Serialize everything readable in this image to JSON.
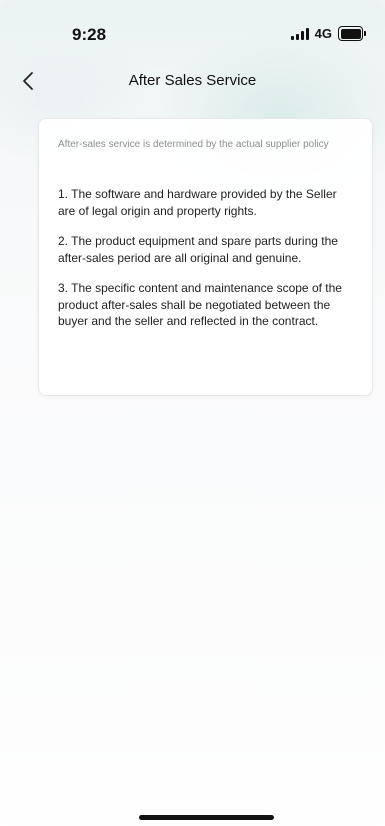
{
  "status_bar": {
    "time": "9:28",
    "network": "4G",
    "icons": [
      "signal-icon",
      "battery-icon"
    ]
  },
  "nav": {
    "back_icon": "chevron-left-icon",
    "title": "After Sales Service"
  },
  "content": {
    "note": "After-sales service is determined by the actual supplier policy",
    "items": [
      "1. The software and hardware provided by the Seller are of legal origin and property rights.",
      "2. The product equipment and spare parts during the after-sales period are all original and genuine.",
      "3. The specific content and maintenance scope of the product after-sales shall be negotiated between the buyer and the seller and reflected in the contract."
    ]
  }
}
